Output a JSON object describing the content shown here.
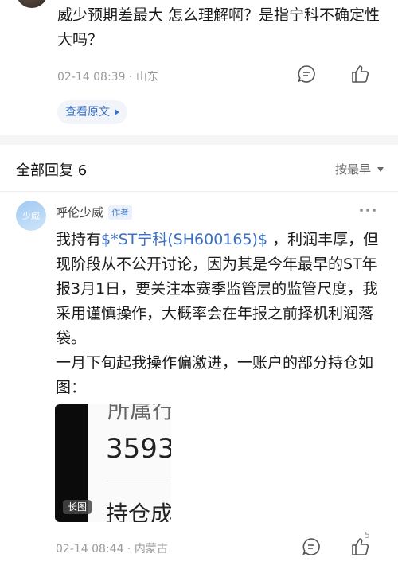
{
  "prev_comment": {
    "text": "威少预期差最大 怎么理解啊？是指宁科不确定性大吗？",
    "meta": "02-14 08:39 · 山东",
    "view_original": "查看原文"
  },
  "replies_header": {
    "title": "全部回复 6",
    "sort_label": "按最早"
  },
  "reply": {
    "avatar_text": "少威",
    "username": "呼伦少威",
    "author_tag": "作者",
    "text_prefix": "我持有",
    "stock_link": "$*ST宁科(SH600165)$",
    "text_rest": " ，利润丰厚，但现阶段从不公开讨论，因为其是今年最早的ST年报3月1日，要关注本赛季监管层的监管尺度，我采用谨慎操作，大概率会在年报之前择机利润落袋。",
    "text_para2": "一月下旬起我操作偏激进，一账户的部分持仓如图：",
    "image": {
      "partial_text_top": "所属行",
      "partial_number": "3593",
      "partial_text_bottom": "持仓成",
      "long_image_tag": "长图"
    },
    "meta": "02-14 08:44 · 内蒙古",
    "like_count": "5"
  },
  "icons": [
    "comment-icon",
    "like-icon",
    "more-icon",
    "triangle-right-icon",
    "triangle-down-icon"
  ],
  "colors": {
    "link": "#3a6fc4",
    "meta": "#9a9a9a",
    "separator": "#f4f5f7"
  }
}
